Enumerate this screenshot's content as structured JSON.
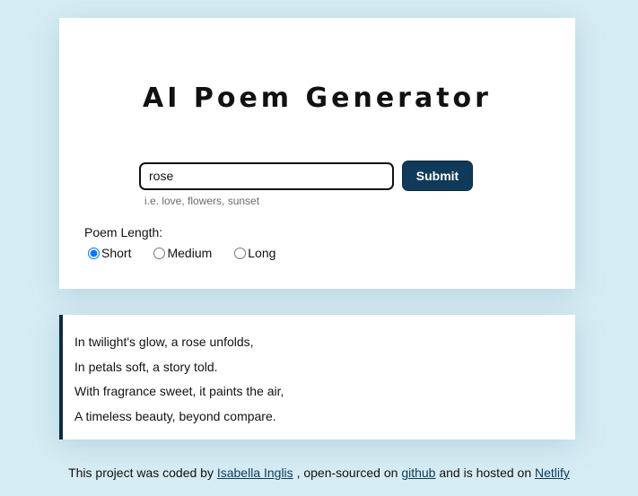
{
  "header": {
    "title": "AI Poem Generator"
  },
  "form": {
    "input_value": "rose",
    "hint": "i.e. love, flowers, sunset",
    "submit_label": "Submit",
    "length_label": "Poem Length:",
    "length_options": [
      {
        "label": "Short",
        "selected": true
      },
      {
        "label": "Medium",
        "selected": false
      },
      {
        "label": "Long",
        "selected": false
      }
    ]
  },
  "poem": {
    "lines": [
      "In twilight's glow, a rose unfolds,",
      "In petals soft, a story told.",
      "With fragrance sweet, it paints the air,",
      "A timeless beauty, beyond compare."
    ]
  },
  "footer": {
    "text_1": "This project was coded by",
    "author_link": "Isabella Inglis",
    "text_2": ", open-sourced on",
    "github_link": "github",
    "text_3": "and is hosted on",
    "netlify_link": "Netlify"
  },
  "colors": {
    "background": "#d6ecf3",
    "button": "#0f3a5a",
    "poem_border": "#0f2a40"
  }
}
